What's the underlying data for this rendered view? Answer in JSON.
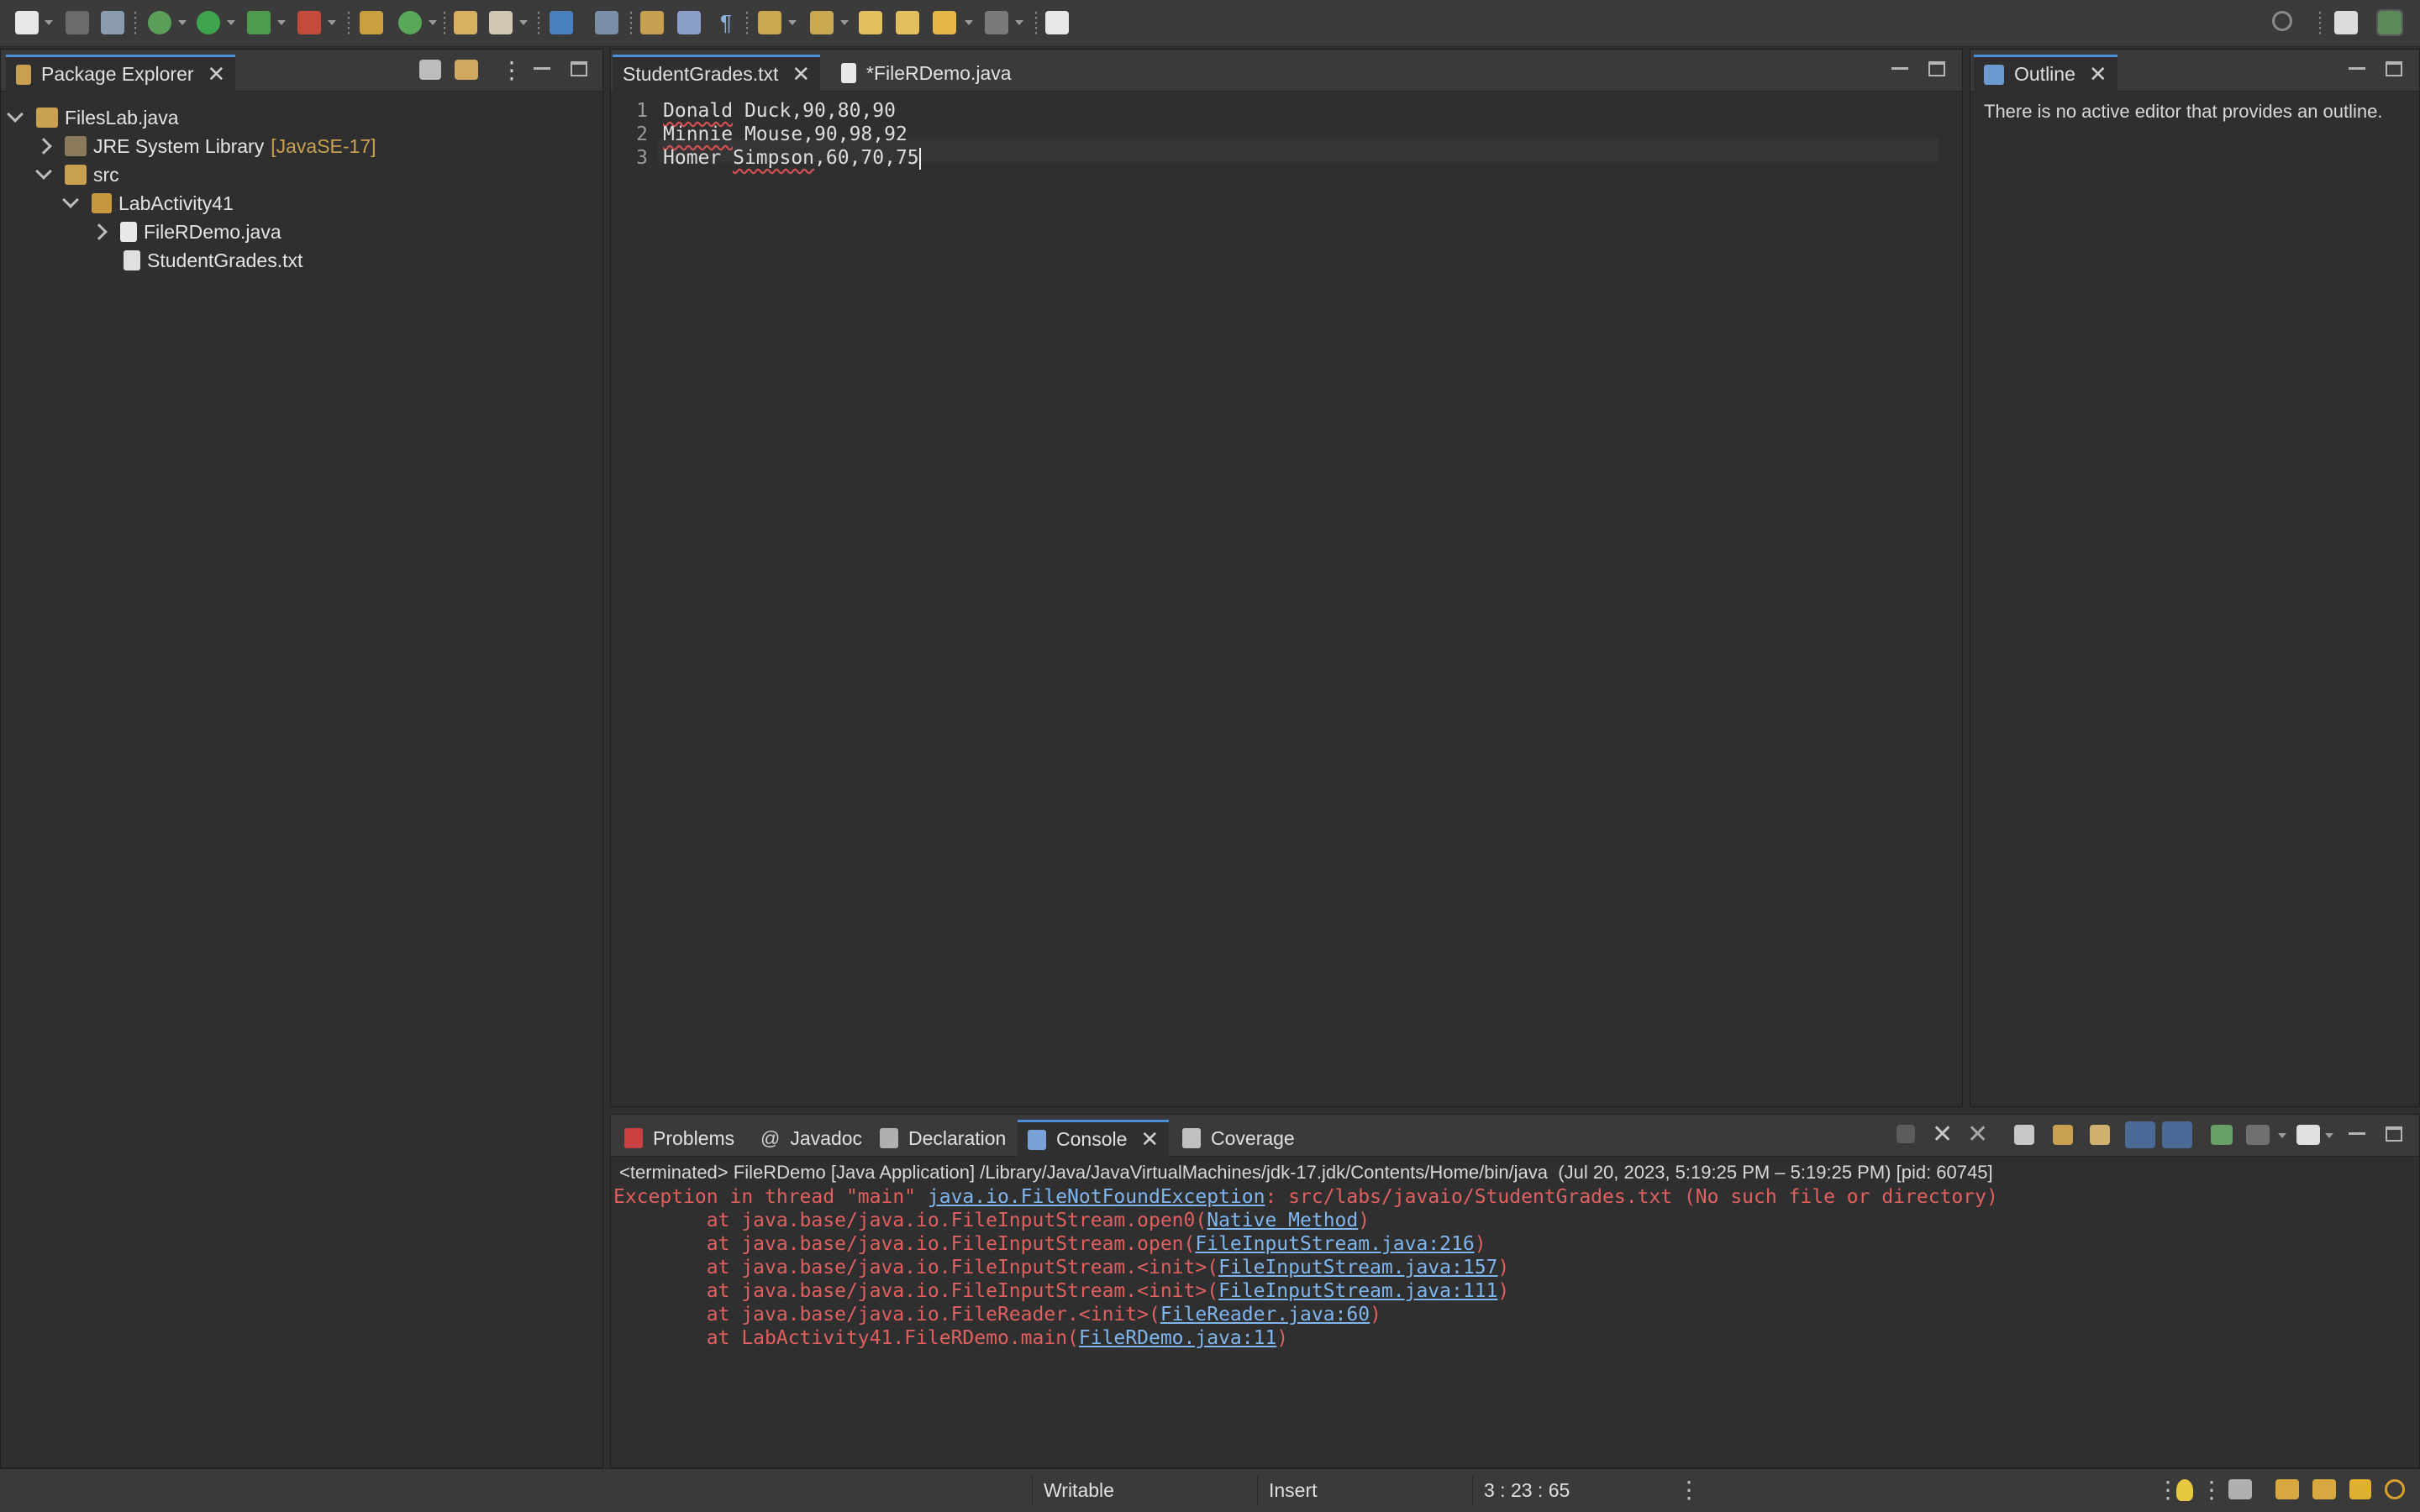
{
  "toolbar": {
    "icons": [
      "new-icon",
      "save-icon",
      "save-all-icon",
      "debug-icon",
      "run-icon",
      "coverage-run-icon",
      "external-tools-icon",
      "new-java-package-icon",
      "new-java-class-icon",
      "open-type-icon",
      "search-icon",
      "toggle-mark-occurrences-icon",
      "toggle-block-selection-icon",
      "show-whitespace-icon",
      "next-annotation-icon",
      "previous-annotation-icon",
      "last-edit-location-icon",
      "back-icon",
      "forward-icon",
      "pin-editor-icon"
    ],
    "right_icons": [
      "quick-search-icon",
      "open-perspective-icon",
      "java-perspective-icon"
    ]
  },
  "package_explorer": {
    "title": "Package Explorer",
    "items": [
      {
        "label": "FilesLab.java",
        "decoration": ""
      },
      {
        "label": "JRE System Library",
        "decoration": "[JavaSE-17]"
      },
      {
        "label": "src",
        "decoration": ""
      },
      {
        "label": "LabActivity41",
        "decoration": ""
      },
      {
        "label": "FileRDemo.java",
        "decoration": ""
      },
      {
        "label": "StudentGrades.txt",
        "decoration": ""
      }
    ]
  },
  "editor": {
    "tabs": [
      {
        "label": "StudentGrades.txt"
      },
      {
        "label": "*FileRDemo.java"
      }
    ],
    "lines": [
      {
        "num": "1",
        "misspelled": "Donald",
        "rest": " Duck,90,80,90"
      },
      {
        "num": "2",
        "misspelled": "Minnie",
        "rest": " Mouse,90,98,92"
      },
      {
        "num": "3",
        "prefix": "Homer ",
        "misspelled": "Simpson",
        "rest": ",60,70,75"
      }
    ]
  },
  "outline": {
    "title": "Outline",
    "message": "There is no active editor that provides an outline."
  },
  "bottom_panel": {
    "tabs": [
      {
        "label": "Problems"
      },
      {
        "label": "Javadoc"
      },
      {
        "label": "Declaration"
      },
      {
        "label": "Console"
      },
      {
        "label": "Coverage"
      }
    ],
    "console_header": "<terminated> FileRDemo [Java Application] /Library/Java/JavaVirtualMachines/jdk-17.jdk/Contents/Home/bin/java  (Jul 20, 2023, 5:19:25 PM – 5:19:25 PM) [pid: 60745]",
    "exception": {
      "prefix": "Exception in thread \"main\" ",
      "class_link": "java.io.FileNotFoundException",
      "message": ": src/labs/javaio/StudentGrades.txt (No such file or directory)"
    },
    "stack": [
      {
        "text": "        at java.base/java.io.FileInputStream.open0(",
        "link": "Native Method",
        "end": ")"
      },
      {
        "text": "        at java.base/java.io.FileInputStream.open(",
        "link": "FileInputStream.java:216",
        "end": ")"
      },
      {
        "text": "        at java.base/java.io.FileInputStream.<init>(",
        "link": "FileInputStream.java:157",
        "end": ")"
      },
      {
        "text": "        at java.base/java.io.FileInputStream.<init>(",
        "link": "FileInputStream.java:111",
        "end": ")"
      },
      {
        "text": "        at java.base/java.io.FileReader.<init>(",
        "link": "FileReader.java:60",
        "end": ")"
      },
      {
        "text": "        at LabActivity41.FileRDemo.main(",
        "link": "FileRDemo.java:11",
        "end": ")"
      }
    ]
  },
  "status": {
    "writable": "Writable",
    "insert_mode": "Insert",
    "position": "3 : 23 : 65"
  },
  "colors": {
    "background": "#2f2f2f",
    "error_text": "#e06060",
    "link": "#7fb6ef",
    "library_decoration": "#c8a050",
    "active_tab_accent": "#4a90d9"
  }
}
